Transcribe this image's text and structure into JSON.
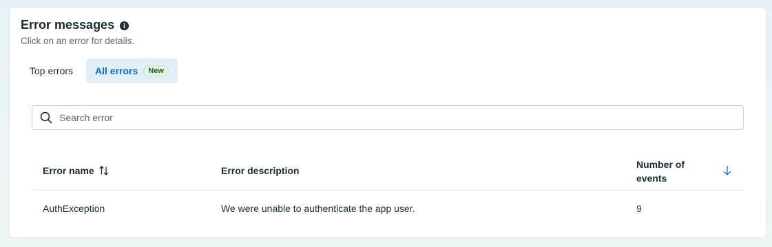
{
  "header": {
    "title": "Error messages",
    "info_icon": "info-icon",
    "subtitle": "Click on an error for details."
  },
  "tabs": [
    {
      "label": "Top errors",
      "active": false
    },
    {
      "label": "All errors",
      "active": true,
      "badge": "New"
    }
  ],
  "search": {
    "placeholder": "Search error",
    "value": "",
    "icon": "search-icon"
  },
  "table": {
    "columns": {
      "name": "Error name",
      "description": "Error description",
      "count": "Number of events"
    },
    "sort": {
      "column": "count",
      "direction": "descending"
    },
    "rows": [
      {
        "name": "AuthException",
        "description": "We were unable to authenticate the app user.",
        "count": "9"
      }
    ]
  },
  "colors": {
    "accent": "#0a6ed1",
    "active_tab_bg": "#e2eff8",
    "badge_text": "#1c5f2f",
    "badge_bg": "#e4f3e6"
  }
}
